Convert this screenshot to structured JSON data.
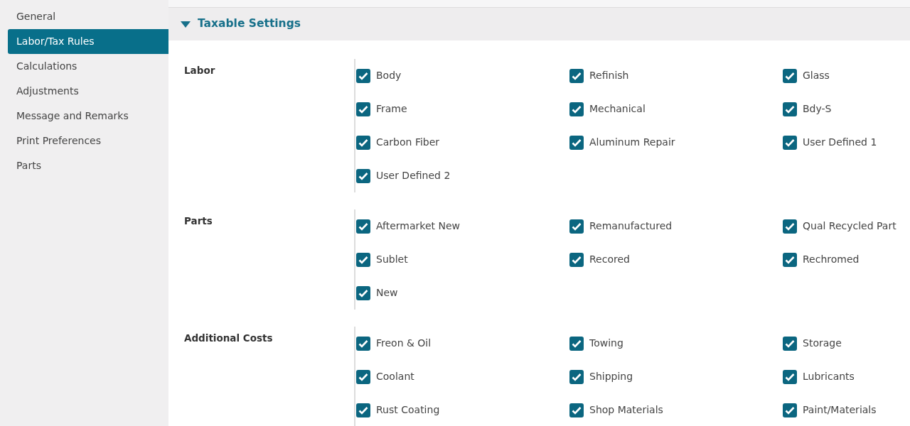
{
  "sidebar": {
    "items": [
      {
        "label": "General",
        "selected": false
      },
      {
        "label": "Labor/Tax Rules",
        "selected": true
      },
      {
        "label": "Calculations",
        "selected": false
      },
      {
        "label": "Adjustments",
        "selected": false
      },
      {
        "label": "Message and Remarks",
        "selected": false
      },
      {
        "label": "Print Preferences",
        "selected": false
      },
      {
        "label": "Parts",
        "selected": false
      }
    ]
  },
  "section": {
    "title": "Taxable Settings",
    "expanded": true,
    "groups": [
      {
        "label": "Labor",
        "options": [
          {
            "label": "Body",
            "checked": true
          },
          {
            "label": "Refinish",
            "checked": true
          },
          {
            "label": "Glass",
            "checked": true
          },
          {
            "label": "Frame",
            "checked": true
          },
          {
            "label": "Mechanical",
            "checked": true
          },
          {
            "label": "Bdy-S",
            "checked": true
          },
          {
            "label": "Carbon Fiber",
            "checked": true
          },
          {
            "label": "Aluminum Repair",
            "checked": true
          },
          {
            "label": "User Defined 1",
            "checked": true
          },
          {
            "label": "User Defined 2",
            "checked": true
          }
        ]
      },
      {
        "label": "Parts",
        "options": [
          {
            "label": "Aftermarket New",
            "checked": true
          },
          {
            "label": "Remanufactured",
            "checked": true
          },
          {
            "label": "Qual Recycled Part",
            "checked": true
          },
          {
            "label": "Sublet",
            "checked": true
          },
          {
            "label": "Recored",
            "checked": true
          },
          {
            "label": "Rechromed",
            "checked": true
          },
          {
            "label": "New",
            "checked": true
          }
        ]
      },
      {
        "label": "Additional Costs",
        "options": [
          {
            "label": "Freon & Oil",
            "checked": true
          },
          {
            "label": "Towing",
            "checked": true
          },
          {
            "label": "Storage",
            "checked": true
          },
          {
            "label": "Coolant",
            "checked": true
          },
          {
            "label": "Shipping",
            "checked": true
          },
          {
            "label": "Lubricants",
            "checked": true
          },
          {
            "label": "Rust Coating",
            "checked": true
          },
          {
            "label": "Shop Materials",
            "checked": true
          },
          {
            "label": "Paint/Materials",
            "checked": true
          }
        ]
      }
    ]
  }
}
